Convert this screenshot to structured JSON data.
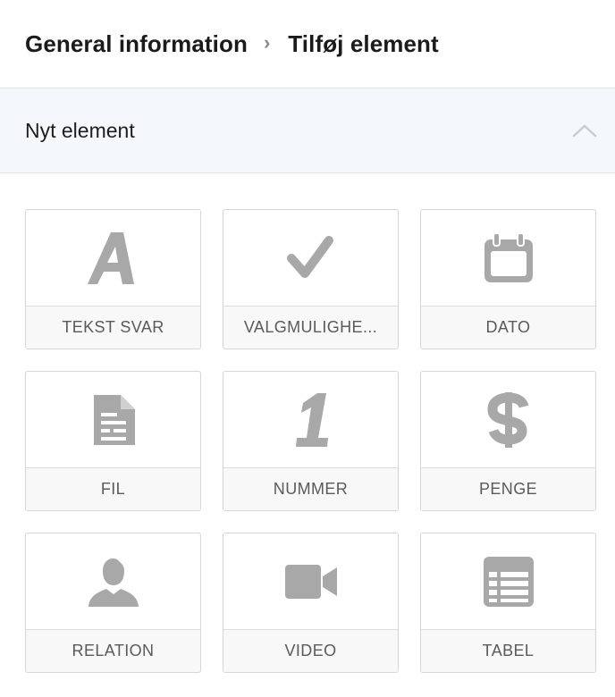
{
  "breadcrumb": {
    "parent": "General information",
    "separator": "›",
    "current": "Tilføj element"
  },
  "section": {
    "title": "Nyt element",
    "toggle_icon": "chevron-up-icon"
  },
  "tiles": [
    {
      "label": "TEKST SVAR",
      "icon": "letter-a-icon"
    },
    {
      "label": "VALGMULIGHE...",
      "icon": "checkmark-icon"
    },
    {
      "label": "DATO",
      "icon": "calendar-icon"
    },
    {
      "label": "FIL",
      "icon": "document-icon"
    },
    {
      "label": "NUMMER",
      "icon": "number-one-icon"
    },
    {
      "label": "PENGE",
      "icon": "dollar-icon"
    },
    {
      "label": "RELATION",
      "icon": "person-icon"
    },
    {
      "label": "VIDEO",
      "icon": "video-camera-icon"
    },
    {
      "label": "TABEL",
      "icon": "table-icon"
    }
  ],
  "colors": {
    "icon": "#a8a8a8",
    "section_bg": "#f4f8fc",
    "label_bg": "#f8f8f8",
    "border": "#d6d6d6"
  }
}
